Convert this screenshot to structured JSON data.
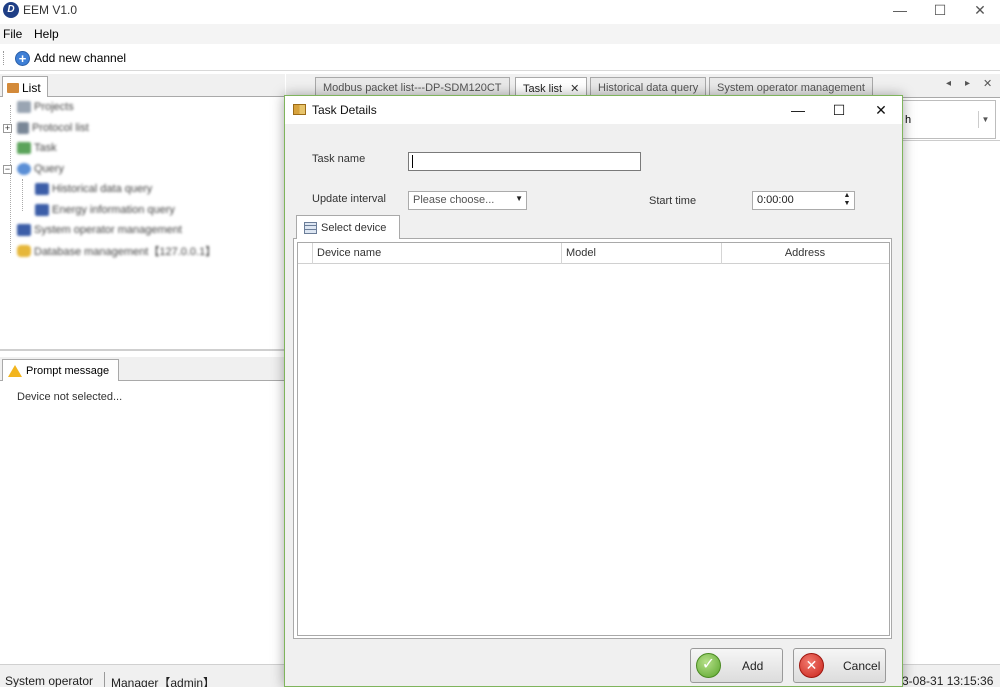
{
  "window": {
    "title": "EEM V1.0",
    "logo_text": "D",
    "controls": {
      "minimize": "—",
      "maximize": "☐",
      "close": "✕"
    }
  },
  "menu": {
    "file": "File",
    "help": "Help"
  },
  "toolbar": {
    "add_channel": "Add new channel"
  },
  "left_panel": {
    "tab_label": "List",
    "tree": [
      {
        "label": "Projects"
      },
      {
        "label": "Protocol list"
      },
      {
        "label": "Task"
      },
      {
        "label": "Query"
      },
      {
        "label": "Historical data query"
      },
      {
        "label": "Energy information query"
      },
      {
        "label": "System operator management"
      },
      {
        "label": "Database management【127.0.0.1】"
      }
    ]
  },
  "prompt_panel": {
    "tab_label": "Prompt message",
    "message": "Device not selected..."
  },
  "doc_tabs": [
    {
      "label": "Modbus packet list---DP-SDM120CT"
    },
    {
      "label": "Task list",
      "close": "✕"
    },
    {
      "label": "Historical data query"
    },
    {
      "label": "System operator management"
    }
  ],
  "doc_nav": {
    "prev": "◂",
    "next": "▸",
    "close": "✕"
  },
  "background_combo": {
    "text": "h",
    "arrow": "▼"
  },
  "dialog": {
    "title": "Task Details",
    "controls": {
      "minimize": "—",
      "maximize": "☐",
      "close": "✕"
    },
    "task_name_label": "Task name",
    "task_name_value": "",
    "update_interval_label": "Update interval",
    "update_interval_value": "Please choose...",
    "start_time_label": "Start time",
    "start_time_value": "0:00:00",
    "select_device_tab": "Select device",
    "columns": [
      "Device name",
      "Model",
      "Address"
    ],
    "add_label": "Add",
    "cancel_label": "Cancel"
  },
  "statusbar": {
    "role": "System operator",
    "user": "Manager【admin】",
    "datetime": "3-08-31 13:15:36"
  }
}
